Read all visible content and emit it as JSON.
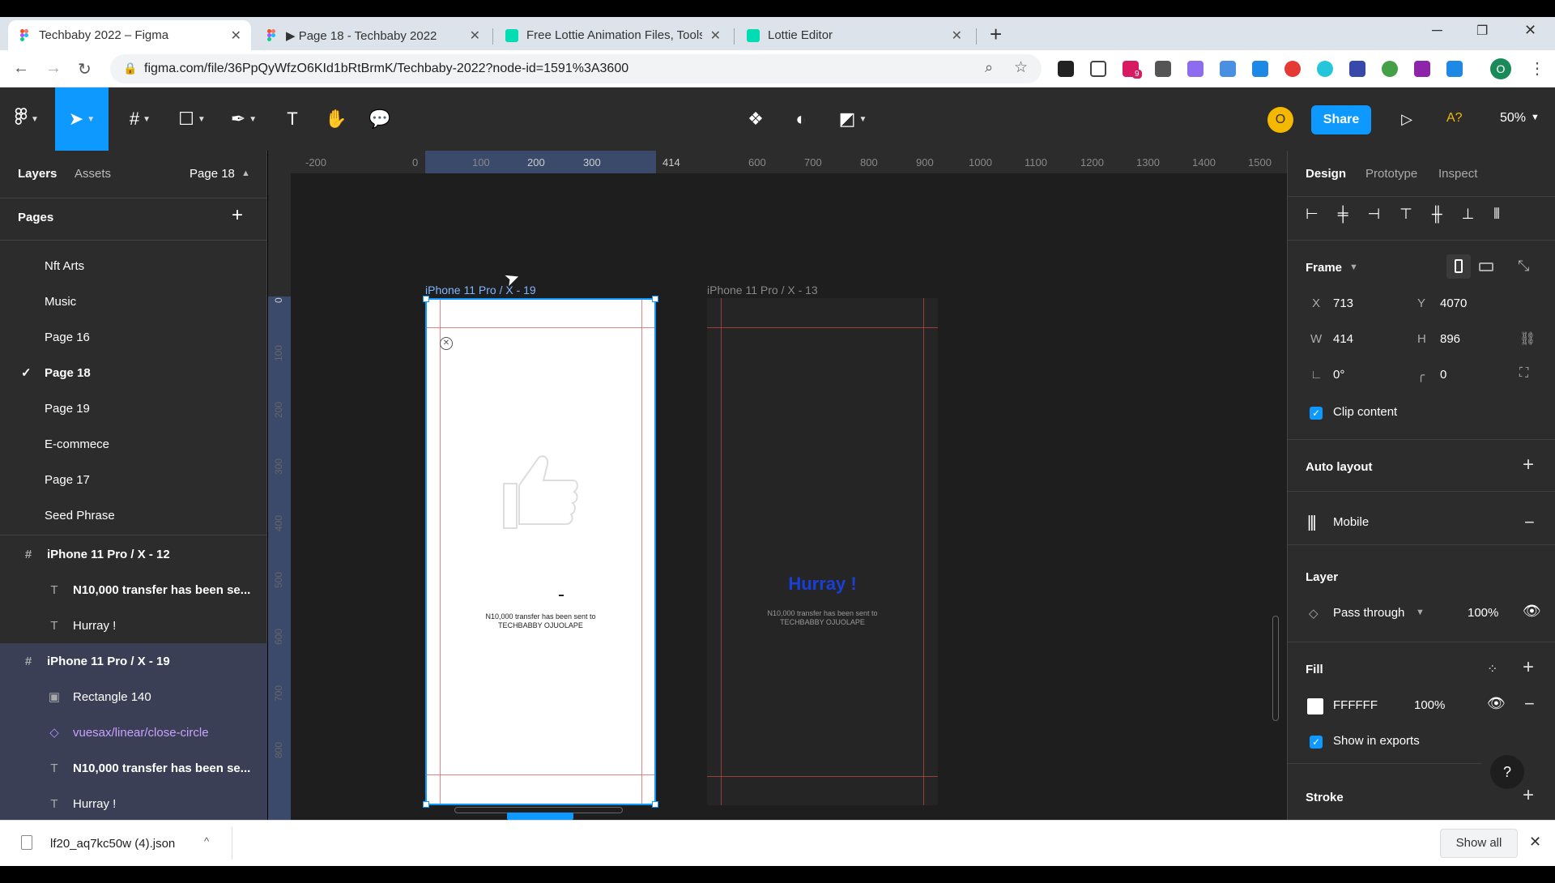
{
  "browser": {
    "tabs": [
      {
        "title": "Techbaby 2022 – Figma",
        "active": true
      },
      {
        "title": "▶ Page 18 - Techbaby 2022",
        "active": false
      },
      {
        "title": "Free Lottie Animation Files, Tools",
        "active": false
      },
      {
        "title": "Lottie Editor",
        "active": false
      }
    ],
    "new_tab": "+",
    "url": "figma.com/file/36PpQyWfzO6KId1bRtBrmK/Techbaby-2022?node-id=1591%3A3600",
    "profile_initial": "O",
    "ext_badge": "9"
  },
  "toolbar": {
    "avatar_initial": "O",
    "share_label": "Share",
    "a_label": "A?",
    "zoom": "50%"
  },
  "left": {
    "tab_layers": "Layers",
    "tab_assets": "Assets",
    "page_selector": "Page 18",
    "pages_heading": "Pages",
    "pages": [
      "Nft Arts",
      "Music",
      "Page 16",
      "Page 18",
      "Page 19",
      "E-commece",
      "Page 17",
      "Seed Phrase"
    ],
    "current_page_check": "✓",
    "layers": [
      {
        "label": "iPhone 11 Pro / X - 12",
        "kind": "frame"
      },
      {
        "label": "N10,000 transfer has been se...",
        "kind": "text"
      },
      {
        "label": "Hurray !",
        "kind": "text"
      },
      {
        "label": "iPhone 11 Pro / X - 19",
        "kind": "frame"
      },
      {
        "label": "Rectangle 140",
        "kind": "image"
      },
      {
        "label": "vuesax/linear/close-circle",
        "kind": "component"
      },
      {
        "label": "N10,000 transfer has been se...",
        "kind": "text"
      },
      {
        "label": "Hurray !",
        "kind": "text"
      }
    ]
  },
  "canvas": {
    "hruler": [
      "-200",
      "0",
      "100",
      "200",
      "300",
      "414",
      "600",
      "700",
      "800",
      "900",
      "1000",
      "1100",
      "1200",
      "1300",
      "1400",
      "1500"
    ],
    "vruler": [
      "0",
      "100",
      "200",
      "300",
      "400",
      "500",
      "600",
      "700",
      "800"
    ],
    "frame1_label": "iPhone 11 Pro / X - 19",
    "frame2_label": "iPhone 11 Pro / X - 13",
    "frame1_msg_line1": "N10,000 transfer has been sent to",
    "frame1_msg_line2": "TECHBABBY OJUOLAPE",
    "frame2_title": "Hurray !",
    "frame2_msg_line1": "N10,000 transfer has been sent to",
    "frame2_msg_line2": "TECHBABBY OJUOLAPE"
  },
  "right": {
    "tab_design": "Design",
    "tab_prototype": "Prototype",
    "tab_inspect": "Inspect",
    "frame_label": "Frame",
    "x_label": "X",
    "x_value": "713",
    "y_label": "Y",
    "y_value": "4070",
    "w_label": "W",
    "w_value": "414",
    "h_label": "H",
    "h_value": "896",
    "rotation": "0°",
    "radius": "0",
    "clip_content": "Clip content",
    "auto_layout": "Auto layout",
    "grid_name": "Mobile",
    "layer_label": "Layer",
    "blend_mode": "Pass through",
    "layer_opacity": "100%",
    "fill_label": "Fill",
    "fill_hex": "FFFFFF",
    "fill_opacity": "100%",
    "show_in_exports": "Show in exports",
    "stroke_label": "Stroke",
    "help": "?"
  },
  "downloads": {
    "file_name": "lf20_aq7kc50w (4).json",
    "show_all": "Show all"
  },
  "colors": {
    "accent": "#0d99ff",
    "hurray_blue": "#1a3fd6",
    "guide_red": "#e05050"
  }
}
